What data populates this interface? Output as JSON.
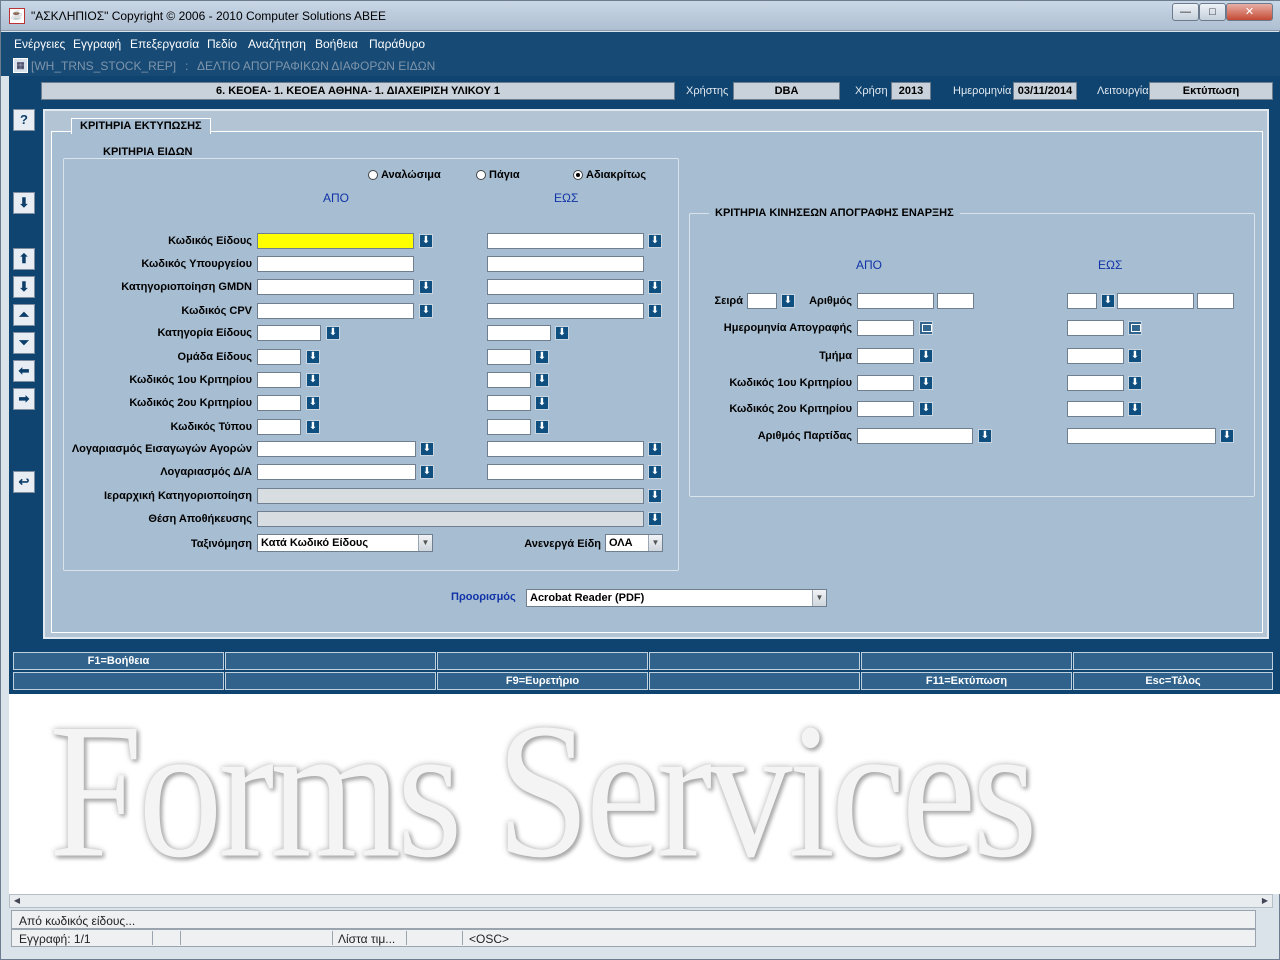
{
  "window": {
    "title": "\"ΑΣΚΛΗΠΙΟΣ\" Copyright © 2006 - 2010 Computer Solutions ABEE",
    "min": "—",
    "max": "□",
    "close": "✕"
  },
  "menu": [
    "Ενέργειες",
    "Εγγραφή",
    "Επεξεργασία",
    "Πεδίο",
    "Αναζήτηση",
    "Βοήθεια",
    "Παράθυρο"
  ],
  "crumb": {
    "form_code": "[WH_TRNS_STOCK_REP]",
    "sep": ":",
    "form_title": "ΔΕΛΤΙΟ ΑΠΟΓΡΑΦΙΚΩΝ ΔΙΑΦΟΡΩΝ ΕΙΔΩΝ"
  },
  "header": {
    "company": "6. ΚΕΟΕΑ- 1. ΚΕΟΕΑ ΑΘΗΝΑ- 1. ΔΙΑΧΕΙΡΙΣΗ ΥΛΙΚΟΥ 1",
    "user_label": "Χρήστης",
    "user": "DBA",
    "year_label": "Χρήση",
    "year": "2013",
    "date_label": "Ημερομηνία",
    "date": "03/11/2014",
    "mode_label": "Λειτουργία",
    "mode": "Εκτύπωση"
  },
  "toolbar": {
    "help": "?",
    "down": "⬇",
    "first": "⬆",
    "last": "⬇",
    "prev": "⏶",
    "next": "⏷",
    "left": "⬅",
    "right": "➡",
    "undo": "↩"
  },
  "tab": {
    "label": "ΚΡΙΤΗΡΙΑ ΕΚΤΥΠΩΣΗΣ"
  },
  "items": {
    "group_title": "ΚΡΙΤΗΡΙΑ ΕΙΔΩΝ",
    "radio": [
      "Αναλώσιμα",
      "Πάγια",
      "Αδιακρίτως"
    ],
    "from": "ΑΠΟ",
    "to": "ΕΩΣ",
    "labels": [
      "Κωδικός Είδους",
      "Κωδικός Υπουργείου",
      "Κατηγοριοποίηση GMDN",
      "Κωδικός CPV",
      "Κατηγορία Είδους",
      "Ομάδα Είδους",
      "Κωδικός 1ου Κριτηρίου",
      "Κωδικός 2ου Κριτηρίου",
      "Κωδικός Τύπου",
      "Λογαριασμός Εισαγωγών Αγορών",
      "Λογαριασμός Δ/Α",
      "Ιεραρχική Κατηγοριοποίηση",
      "Θέση Αποθήκευσης",
      "Ταξινόμηση"
    ],
    "sort_value": "Κατά Κωδικό Είδους",
    "inactive_label": "Ανενεργά Είδη",
    "inactive_value": "ΟΛΑ"
  },
  "moves": {
    "group_title": "ΚΡΙΤΗΡΙΑ ΚΙΝΗΣΕΩΝ ΑΠΟΓΡΑΦΗΣ ΕΝΑΡΞΗΣ",
    "from": "ΑΠΟ",
    "to": "ΕΩΣ",
    "series": "Σειρά",
    "number": "Αριθμός",
    "labels": [
      "Ημερομηνία Απογραφής",
      "Τμήμα",
      "Κωδικός 1ου Κριτηρίου",
      "Κωδικός 2ου Κριτηρίου",
      "Αριθμός Παρτίδας"
    ]
  },
  "destination": {
    "label": "Προορισμός",
    "value": "Acrobat Reader (PDF)"
  },
  "fkeys_row1": [
    "F1=Βοήθεια",
    "",
    "",
    "",
    "",
    ""
  ],
  "fkeys_row2": [
    "",
    "",
    "F9=Ευρετήριο",
    "",
    "F11=Εκτύπωση",
    "Esc=Τέλος"
  ],
  "watermark": "Forms Services",
  "status": {
    "message": "Από κωδικός είδους...",
    "record": "Εγγραφή: 1/1",
    "list": "Λίστα τιμ...",
    "osc": "<OSC>"
  }
}
